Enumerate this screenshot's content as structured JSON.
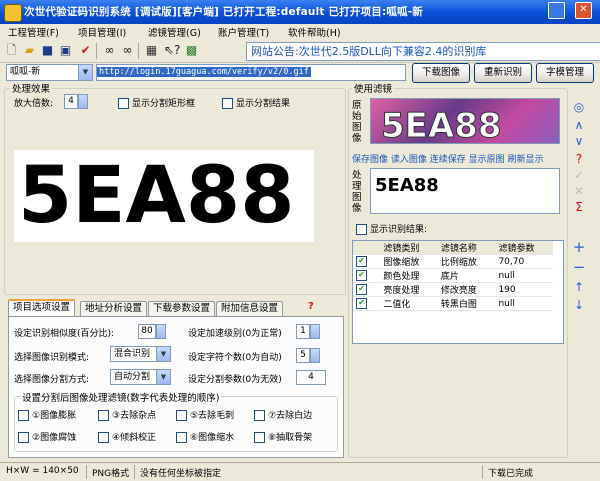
{
  "window": {
    "title": "次世代验证码识别系统 [调试版][客户端] 已打开工程:default 已打开项目:呱呱-新"
  },
  "menu": {
    "items": [
      "工程管理(F)",
      "项目管理(I)",
      "滤镜管理(G)",
      "账户管理(T)",
      "软件帮助(H)"
    ]
  },
  "toolbar": {
    "notice": "网站公告:次世代2.5版DLL向下兼容2.4的识别库",
    "icons": [
      "new-icon",
      "open-icon",
      "save-icon",
      "save-as-icon",
      "check-icon",
      "binoculars-icon",
      "binoculars-icon",
      "grid-icon",
      "help-pointer-icon",
      "image-icon"
    ]
  },
  "project": {
    "select": "呱呱-新",
    "url": "http://login.17guagua.com/verify/v2/0.gif"
  },
  "buttons": {
    "download": "下载图像",
    "reidentify": "重新识别",
    "font_manage": "字模管理"
  },
  "preview": {
    "group_label": "处理效果",
    "zoom_label": "放大倍数:",
    "zoom_value": "4",
    "show_rect": "显示分割矩形框",
    "show_result": "显示分割结果",
    "captcha_text": "5EA88"
  },
  "filter_panel": {
    "group_label": "使用滤镜",
    "original_label": "原始图像",
    "processed_label": "处理图像",
    "original_text": "5EA88",
    "processed_text": "5EA88",
    "links": [
      "保存图像",
      "读入图像",
      "连续保存",
      "显示原图",
      "刷新显示"
    ],
    "show_result": "显示识别结果:",
    "columns": [
      "滤镜类别",
      "滤镜名称",
      "滤镜参数"
    ],
    "rows": [
      {
        "category": "图像缩放",
        "name": "比例缩放",
        "param": "70,70"
      },
      {
        "category": "颜色处理",
        "name": "底片",
        "param": "null"
      },
      {
        "category": "亮度处理",
        "name": "修改亮度",
        "param": "190"
      },
      {
        "category": "二值化",
        "name": "转黑白图",
        "param": "null"
      }
    ]
  },
  "tabs": [
    "项目选项设置",
    "地址分析设置",
    "下载参数设置",
    "附加信息设置"
  ],
  "settings": {
    "similarity_label": "设定识别相似度(百分比):",
    "similarity_value": "80",
    "accel_label": "设定加速级别(0为正常)",
    "accel_value": "1",
    "mode_label": "选择图像识别模式:",
    "mode_value": "混合识别",
    "chars_label": "设定字符个数(0为自动)",
    "chars_value": "5",
    "split_label": "选择图像分割方式:",
    "split_value": "自动分割",
    "split_param_label": "设定分割参数(0为无效)",
    "split_param_value": "4",
    "order_group": "设置分割后图像处理滤镜(数字代表处理的顺序)",
    "options": [
      "①图像膨胀",
      "③去除杂点",
      "⑤去除毛刺",
      "⑦去除白边",
      "②图像腐蚀",
      "④倾斜校正",
      "⑥图像缩水",
      "⑧抽取骨架"
    ]
  },
  "status": {
    "size": "H×W = 140×50",
    "format": "PNG格式",
    "coords": "没有任何坐标被指定",
    "download": "下载已完成"
  }
}
